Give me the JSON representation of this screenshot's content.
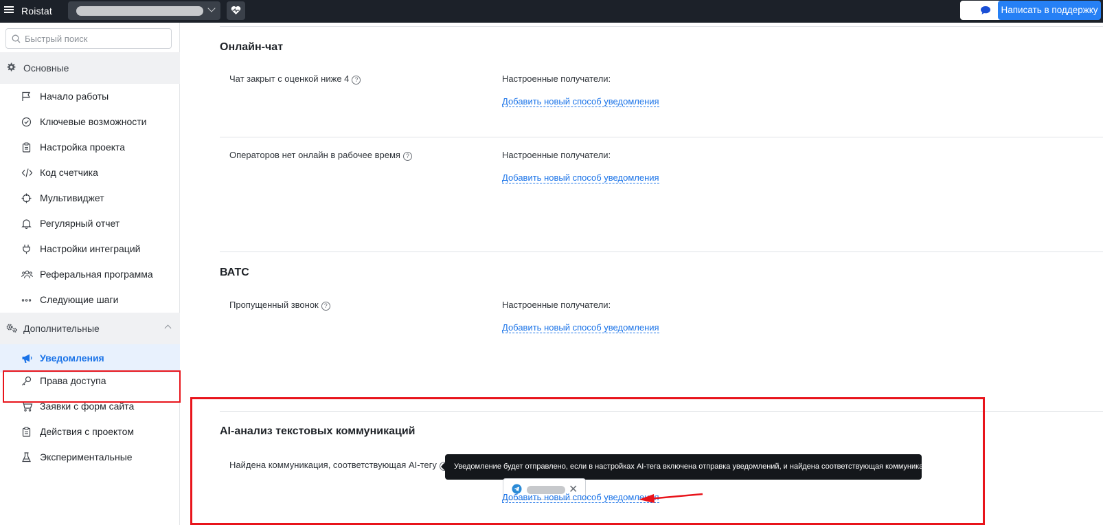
{
  "topbar": {
    "logo": "Roistat",
    "support_label": "Написать в поддержку"
  },
  "sidebar": {
    "search_placeholder": "Быстрый поиск",
    "groups": [
      {
        "label": "Основные",
        "icon": "gear-icon",
        "items": [
          {
            "label": "Начало работы",
            "icon": "flag-icon"
          },
          {
            "label": "Ключевые возможности",
            "icon": "check-circle-icon"
          },
          {
            "label": "Настройка проекта",
            "icon": "clipboard-icon"
          },
          {
            "label": "Код счетчика",
            "icon": "code-icon"
          },
          {
            "label": "Мультивиджет",
            "icon": "crosshair-icon"
          },
          {
            "label": "Регулярный отчет",
            "icon": "bell-icon"
          },
          {
            "label": "Настройки интеграций",
            "icon": "plug-icon"
          },
          {
            "label": "Реферальная программа",
            "icon": "users-icon"
          },
          {
            "label": "Следующие шаги",
            "icon": "dots-icon"
          }
        ]
      },
      {
        "label": "Дополнительные",
        "icon": "gears-icon",
        "items": [
          {
            "label": "Уведомления",
            "icon": "megaphone-icon",
            "active": true
          },
          {
            "label": "Права доступа",
            "icon": "key-icon"
          },
          {
            "label": "Заявки с форм сайта",
            "icon": "cart-icon"
          },
          {
            "label": "Действия с проектом",
            "icon": "clipboard-icon"
          },
          {
            "label": "Экспериментальные",
            "icon": "flask-icon"
          }
        ]
      }
    ]
  },
  "main": {
    "sections": [
      {
        "title": "Онлайн-чат",
        "events": [
          {
            "label": "Чат закрыт с оценкой ниже 4",
            "receivers_label": "Настроенные получатели:",
            "add_link": "Добавить новый способ уведомления"
          },
          {
            "label": "Операторов нет онлайн в рабочее время",
            "receivers_label": "Настроенные получатели:",
            "add_link": "Добавить новый способ уведомления"
          }
        ]
      },
      {
        "title": "ВАТС",
        "events": [
          {
            "label": "Пропущенный звонок",
            "receivers_label": "Настроенные получатели:",
            "add_link": "Добавить новый способ уведомления"
          }
        ]
      },
      {
        "title": "AI-анализ текстовых коммуникаций",
        "events": [
          {
            "label": "Найдена коммуникация, соответствующая AI-тегу",
            "add_link": "Добавить новый способ уведомления"
          }
        ]
      }
    ],
    "tooltip": "Уведомление будет отправлено, если в настройках AI-тега включена отправка уведомлений, и найдена соответствующая коммуникация.",
    "chip_remove": "✕",
    "help_glyph": "?"
  },
  "colors": {
    "topbar": "#1c2129",
    "accent": "#2680f5",
    "link": "#1a73e8",
    "highlight": "#e8141b"
  }
}
